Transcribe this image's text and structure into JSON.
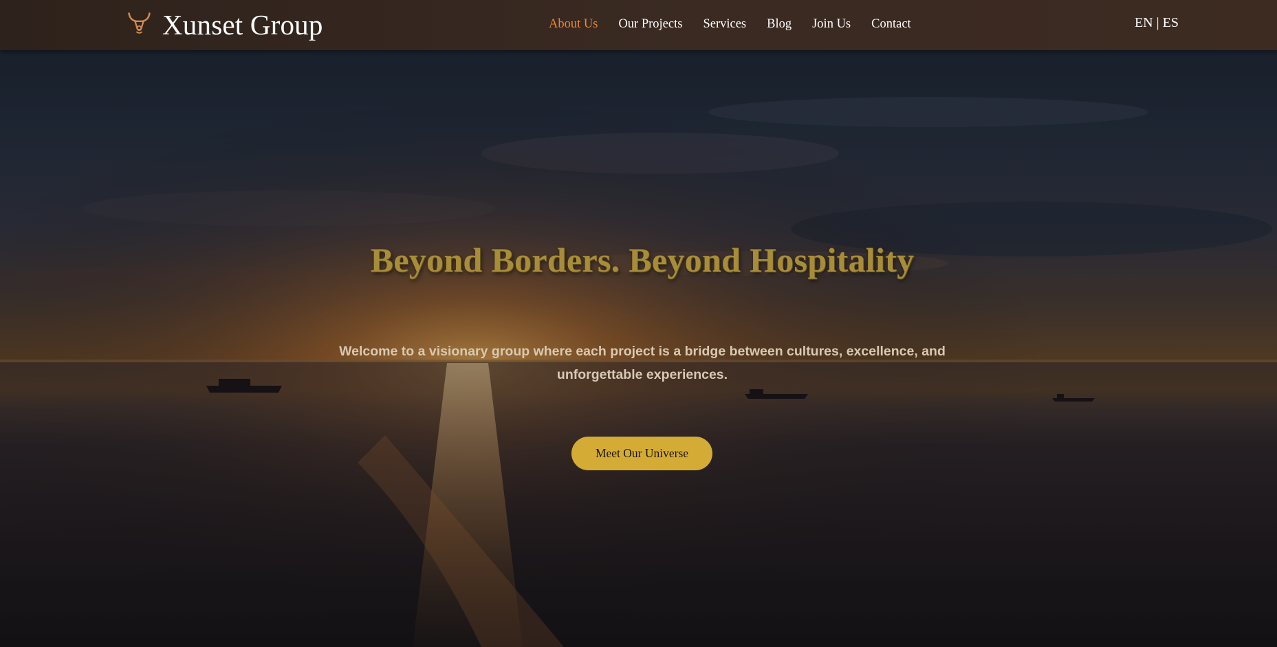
{
  "brand": {
    "name": "Xunset Group",
    "logo_icon": "bull-head-icon",
    "accent_color": "#e8892f"
  },
  "nav": {
    "items": [
      {
        "label": "About Us",
        "active": true
      },
      {
        "label": "Our Projects",
        "active": false
      },
      {
        "label": "Services",
        "active": false
      },
      {
        "label": "Blog",
        "active": false
      },
      {
        "label": "Join Us",
        "active": false
      },
      {
        "label": "Contact",
        "active": false
      }
    ]
  },
  "language": {
    "options": [
      "EN",
      "ES"
    ],
    "separator": " | "
  },
  "hero": {
    "title": "Beyond Borders. Beyond Hospitality",
    "subtitle": "Welcome to a visionary group where each project is a bridge between cultures, excellence, and unforgettable experiences.",
    "cta_label": "Meet Our Universe",
    "title_color": "#a88d39",
    "cta_color": "#d4ac35"
  }
}
